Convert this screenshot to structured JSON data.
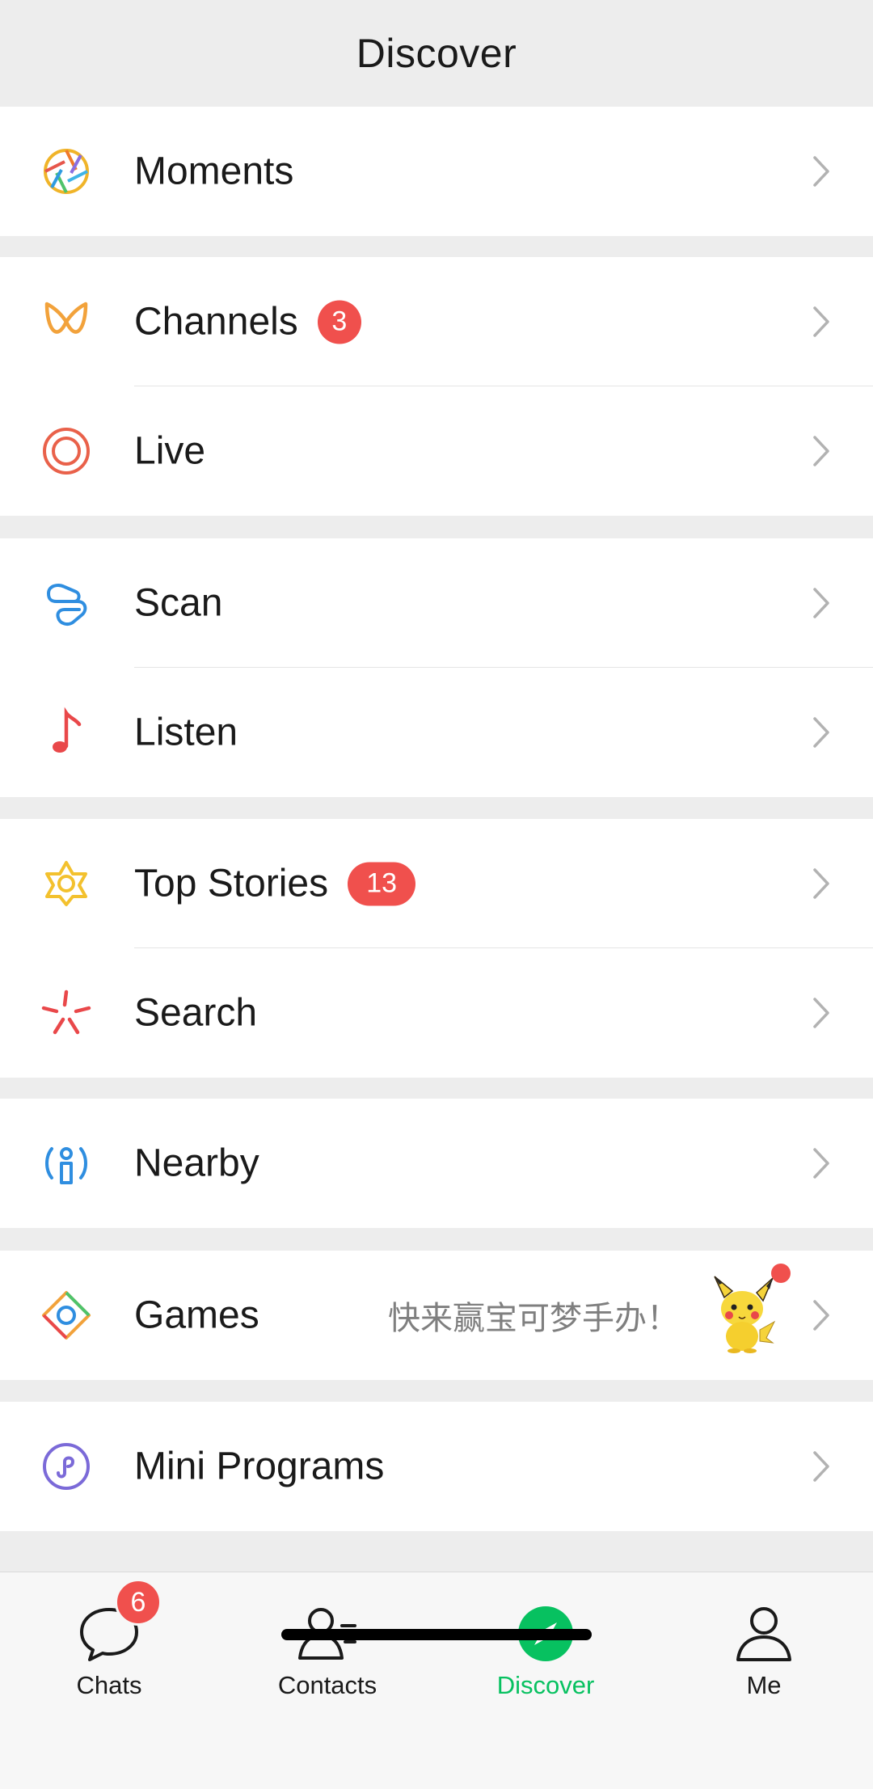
{
  "header": {
    "title": "Discover"
  },
  "rows": {
    "moments": {
      "label": "Moments",
      "icon": "moments-shutter-icon"
    },
    "channels": {
      "label": "Channels",
      "badge": "3",
      "icon": "channels-butterfly-icon"
    },
    "live": {
      "label": "Live",
      "icon": "live-ring-icon"
    },
    "scan": {
      "label": "Scan",
      "icon": "scan-icon"
    },
    "listen": {
      "label": "Listen",
      "icon": "music-note-icon"
    },
    "top_stories": {
      "label": "Top Stories",
      "badge": "13",
      "icon": "top-stories-icon"
    },
    "search": {
      "label": "Search",
      "icon": "search-sparkle-icon"
    },
    "nearby": {
      "label": "Nearby",
      "icon": "nearby-person-icon"
    },
    "games": {
      "label": "Games",
      "hint": "快来赢宝可梦手办！",
      "icon": "games-diamond-icon"
    },
    "mini_programs": {
      "label": "Mini Programs",
      "icon": "mini-programs-icon"
    }
  },
  "tabbar": {
    "tabs": [
      {
        "label": "Chats",
        "badge": "6",
        "icon": "chat-bubble-icon"
      },
      {
        "label": "Contacts",
        "icon": "contacts-icon"
      },
      {
        "label": "Discover",
        "icon": "compass-icon",
        "active": true
      },
      {
        "label": "Me",
        "icon": "person-icon"
      }
    ]
  },
  "colors": {
    "accent": "#07c160",
    "badge": "#f0504d",
    "background": "#ededed"
  }
}
